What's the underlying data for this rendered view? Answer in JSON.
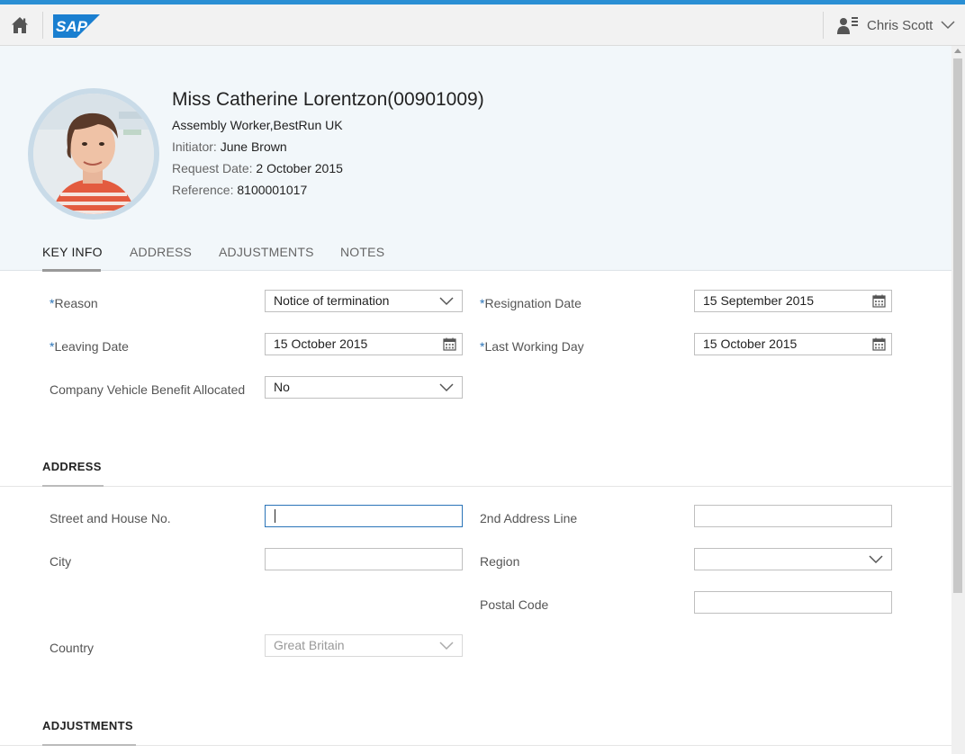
{
  "shell": {
    "user_name": "Chris Scott",
    "logo_text": "SAP",
    "colors": {
      "accent": "#2a8fd4",
      "logo_blue": "#1a7fd0"
    }
  },
  "employee": {
    "name": "Miss Catherine Lorentzon(00901009)",
    "position": "Assembly Worker,BestRun UK",
    "initiator_label": "Initiator:",
    "initiator_value": "June Brown",
    "request_date_label": "Request Date:",
    "request_date_value": "2 October 2015",
    "reference_label": "Reference:",
    "reference_value": "8100001017"
  },
  "tabs": [
    {
      "label": "KEY INFO",
      "active": true
    },
    {
      "label": "ADDRESS",
      "active": false
    },
    {
      "label": "ADJUSTMENTS",
      "active": false
    },
    {
      "label": "NOTES",
      "active": false
    }
  ],
  "key_info": {
    "reason_label": "Reason",
    "reason_value": "Notice of termination",
    "resignation_label": "Resignation Date",
    "resignation_value": "15 September 2015",
    "leaving_label": "Leaving Date",
    "leaving_value": "15 October 2015",
    "last_day_label": "Last Working Day",
    "last_day_value": "15 October 2015",
    "vehicle_label": "Company Vehicle Benefit Allocated",
    "vehicle_value": "No",
    "required_marker": "*"
  },
  "address": {
    "title": "ADDRESS",
    "street_label": "Street and House No.",
    "street_value": "",
    "line2_label": "2nd Address Line",
    "line2_value": "",
    "city_label": "City",
    "city_value": "",
    "region_label": "Region",
    "region_value": "",
    "postal_label": "Postal Code",
    "postal_value": "",
    "country_label": "Country",
    "country_value": "Great Britain"
  },
  "adjustments": {
    "title": "ADJUSTMENTS"
  }
}
